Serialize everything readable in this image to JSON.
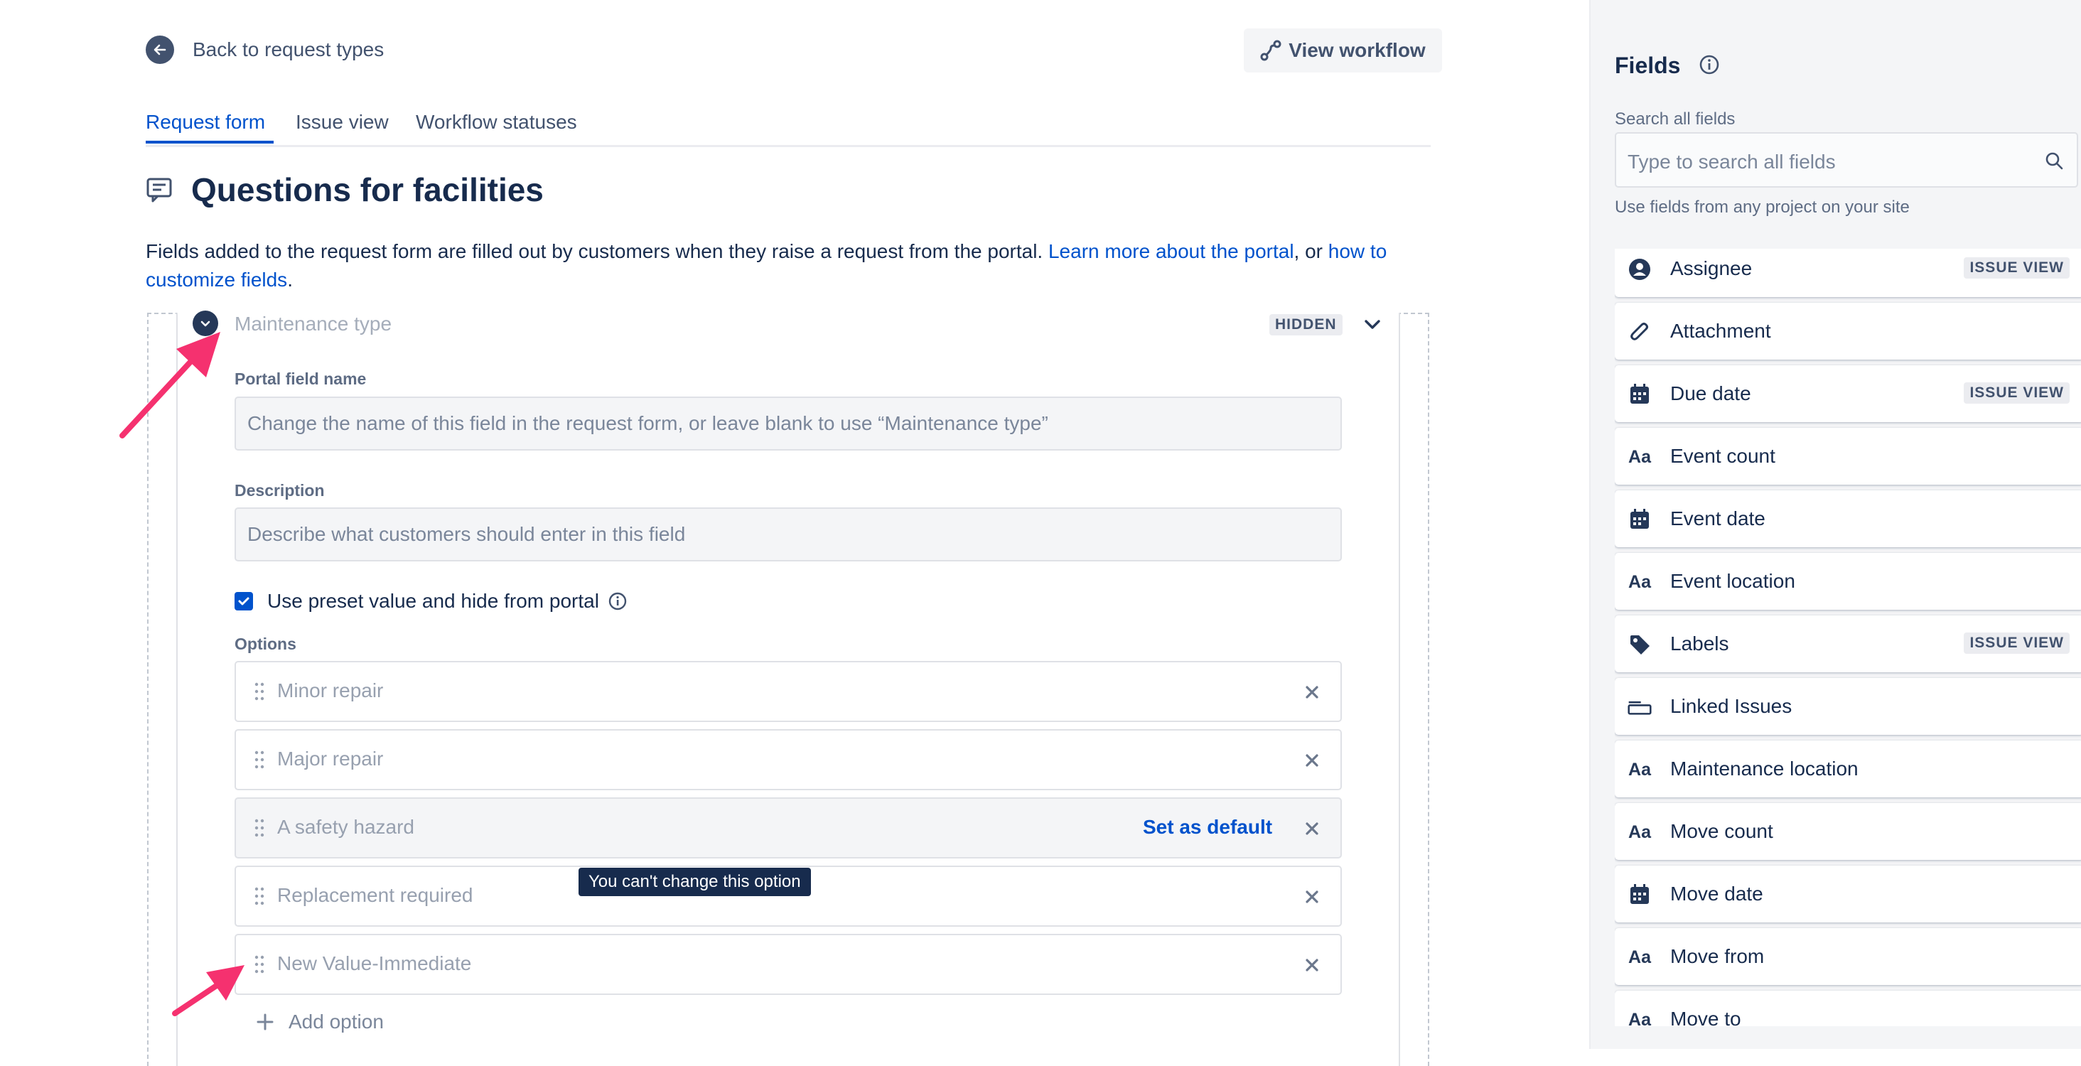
{
  "header": {
    "back_label": "Back to request types",
    "view_workflow_label": "View workflow"
  },
  "tabs": [
    {
      "label": "Request form",
      "active": true
    },
    {
      "label": "Issue view",
      "active": false
    },
    {
      "label": "Workflow statuses",
      "active": false
    }
  ],
  "page": {
    "title": "Questions for facilities",
    "intro_text": "Fields added to the request form are filled out by customers when they raise a request from the portal. ",
    "intro_link1": "Learn more about the portal",
    "intro_mid": ", or ",
    "intro_link2": "how to customize fields",
    "intro_end": "."
  },
  "field": {
    "name": "Maintenance type",
    "badge": "HIDDEN",
    "portal_field_name_label": "Portal field name",
    "portal_field_name_placeholder": "Change the name of this field in the request form, or leave blank to use “Maintenance type”",
    "description_label": "Description",
    "description_placeholder": "Describe what customers should enter in this field",
    "preset_checkbox_label": "Use preset value and hide from portal",
    "preset_checked": true,
    "options_label": "Options",
    "options": [
      {
        "label": "Minor repair"
      },
      {
        "label": "Major repair"
      },
      {
        "label": "A safety hazard",
        "action": "Set as default"
      },
      {
        "label": "Replacement required"
      },
      {
        "label": "New Value-Immediate"
      }
    ],
    "tooltip": "You can't change this option",
    "add_option_label": "Add option"
  },
  "sidebar": {
    "title": "Fields",
    "search_label": "Search all fields",
    "search_placeholder": "Type to search all fields",
    "help_text": "Use fields from any project on your site",
    "items": [
      {
        "label": "Assignee",
        "icon": "person-icon",
        "badge": "ISSUE VIEW"
      },
      {
        "label": "Attachment",
        "icon": "paperclip-icon",
        "badge": ""
      },
      {
        "label": "Due date",
        "icon": "calendar-icon",
        "badge": "ISSUE VIEW"
      },
      {
        "label": "Event count",
        "icon": "text-icon",
        "badge": ""
      },
      {
        "label": "Event date",
        "icon": "calendar-icon",
        "badge": ""
      },
      {
        "label": "Event location",
        "icon": "text-icon",
        "badge": ""
      },
      {
        "label": "Labels",
        "icon": "tag-icon",
        "badge": "ISSUE VIEW"
      },
      {
        "label": "Linked Issues",
        "icon": "link-box-icon",
        "badge": ""
      },
      {
        "label": "Maintenance location",
        "icon": "text-icon",
        "badge": ""
      },
      {
        "label": "Move count",
        "icon": "text-icon",
        "badge": ""
      },
      {
        "label": "Move date",
        "icon": "calendar-icon",
        "badge": ""
      },
      {
        "label": "Move from",
        "icon": "text-icon",
        "badge": ""
      },
      {
        "label": "Move to",
        "icon": "text-icon",
        "badge": ""
      }
    ],
    "text_icon_glyph": "Aa"
  },
  "colors": {
    "accent": "#0052CC",
    "annotation_arrow": "#F5316F",
    "dark": "#172B4D"
  }
}
